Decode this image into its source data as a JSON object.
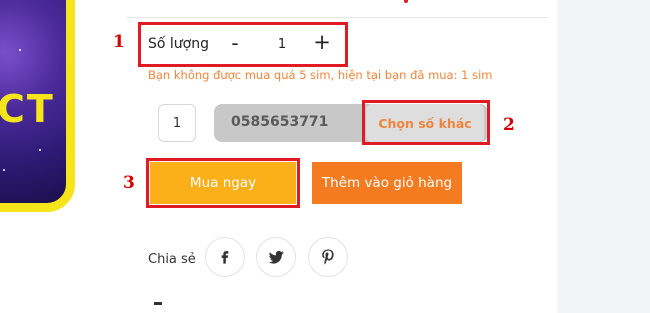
{
  "product": {
    "image_text": "CT"
  },
  "quantity": {
    "label": "Số lượng",
    "minus": "-",
    "value": "1",
    "plus": "+"
  },
  "warning": "Bạn không được mua quá 5 sim, hiện tại bạn đã mua: 1 sim",
  "sim": {
    "count": "1",
    "number": "0585653771",
    "change_button": "Chọn số khác"
  },
  "actions": {
    "buy_now": "Mua ngay",
    "add_to_cart": "Thêm vào giỏ hàng"
  },
  "share": {
    "label": "Chia sẻ",
    "icons": [
      "facebook-icon",
      "twitter-icon",
      "pinterest-icon"
    ]
  },
  "annotations": [
    "1",
    "2",
    "3"
  ],
  "colors": {
    "accent_orange": "#f47b20",
    "buy_yellow": "#fbb01a",
    "warning_text": "#f0843c",
    "annotation_red": "#e01b24"
  }
}
